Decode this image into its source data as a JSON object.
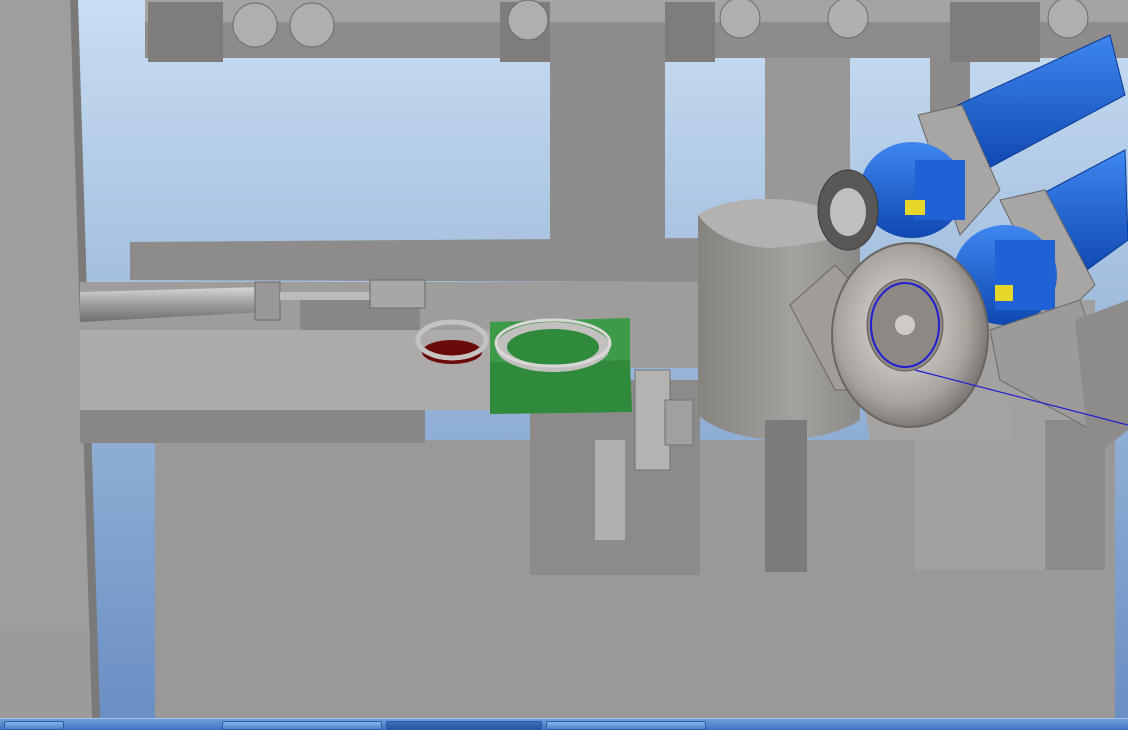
{
  "window": {
    "title": ""
  },
  "scene": {
    "colors": {
      "sky_top": "#c7dcf1",
      "sky_bottom": "#6f94c6",
      "metal_light": "#b0aeac",
      "metal_mid": "#9a9896",
      "metal_dark": "#7c7a78",
      "fixture_green": "#2f8a3c",
      "motor_blue": "#1f62d6",
      "clamp_yellow": "#e6d72a",
      "part_red": "#6a0a0a",
      "path_line": "#2020d0"
    },
    "objects": [
      {
        "id": "left-column",
        "icon": "pillar"
      },
      {
        "id": "overhead-rail",
        "icon": "rail"
      },
      {
        "id": "pneumatic-cylinder",
        "icon": "cylinder"
      },
      {
        "id": "green-fixture",
        "icon": "fixture"
      },
      {
        "id": "robot-pedestal",
        "icon": "pedestal"
      },
      {
        "id": "servo-motor-upper",
        "icon": "motor"
      },
      {
        "id": "servo-motor-lower",
        "icon": "motor"
      },
      {
        "id": "linear-actuator-upper",
        "icon": "actuator"
      },
      {
        "id": "linear-actuator-lower",
        "icon": "actuator"
      },
      {
        "id": "fan-housing-part",
        "icon": "fan"
      },
      {
        "id": "gripped-ring-part",
        "icon": "ring"
      }
    ]
  },
  "taskbar": {
    "buttons": 4
  }
}
